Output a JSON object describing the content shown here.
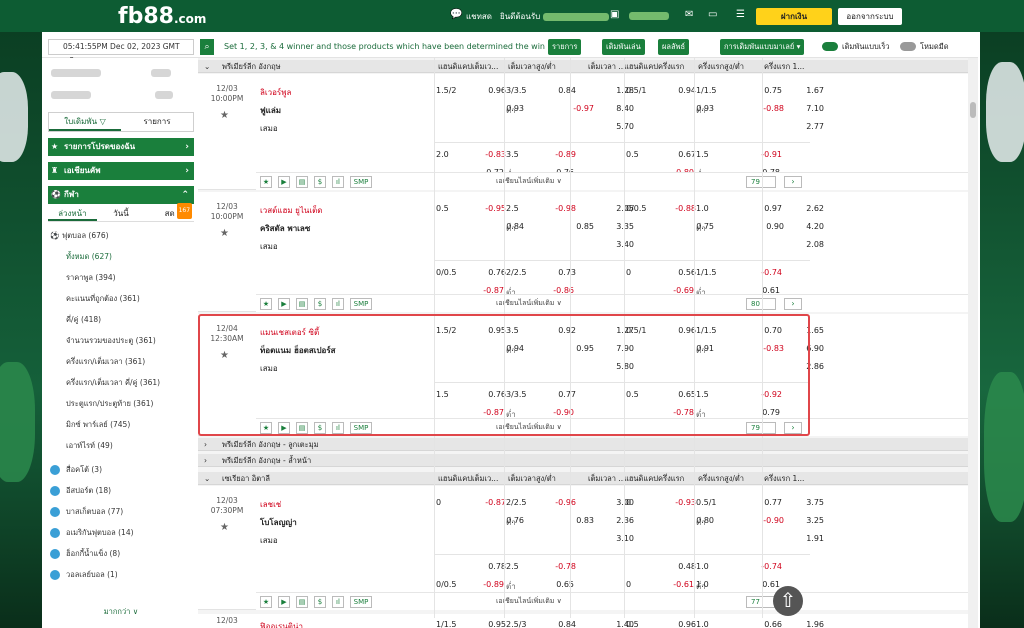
{
  "header": {
    "logo": "fb88",
    "logo_tld": ".com",
    "live_label": "แชทสด",
    "welcome": "ยินดีต้อนรับ",
    "deposit": "ฝากเงิน",
    "logout": "ออกจากระบบ"
  },
  "infobar": {
    "datetime": "05:41:55PM Dec 02, 2023 GMT +8",
    "marquee": "Set 1, 2, 3, & 4 winner and those products which have been determined the win",
    "b1": "รายการ",
    "b2": "เดิมพันเล่น",
    "b3": "ผลลัพธ์",
    "b4": "การเดิมพันแบบมาเลย์ ▾",
    "t1": "เดิมพันแบบเร็ว",
    "t2": "โหมดมืด"
  },
  "sidebar": {
    "tabs": [
      "ใบเดิมพัน ▽",
      "รายการ"
    ],
    "sections": [
      "รายการโปรดของฉัน",
      "เอเชียนคัพ",
      "กีฬา"
    ],
    "subtabs": [
      "ล่วงหน้า",
      "วันนี้",
      "สด"
    ],
    "live_count": "167",
    "items": [
      {
        "icon": "⚽",
        "label": "ฟุตบอล (676)"
      },
      {
        "label": "ทั้งหมด (627)"
      },
      {
        "label": "ราคาพูล (394)"
      },
      {
        "label": "คะแนนที่ถูกต้อง (361)"
      },
      {
        "label": "คี่/คู่ (418)"
      },
      {
        "label": "จำนวนรวมของประตู (361)"
      },
      {
        "label": "ครึ่งแรก/เต็มเวลา (361)"
      },
      {
        "label": "ครึ่งแรก/เต็มเวลา คี่/คู่ (361)"
      },
      {
        "label": "ประตูแรก/ประตูท้าย (361)"
      },
      {
        "label": "มิกซ์ พาร์เลย์ (745)"
      },
      {
        "label": "เอาท์ไรท์ (49)"
      }
    ],
    "others": [
      {
        "label": "สื่อคโต้ (3)"
      },
      {
        "label": "อีสปอร์ต (18)"
      },
      {
        "label": "บาสเก็ตบอล (77)"
      },
      {
        "label": "อเมริกันฟุตบอล (14)"
      },
      {
        "label": "ฮ็อกกี้น้ำแข็ง (8)"
      },
      {
        "label": "วอลเลย์บอล (1)"
      }
    ],
    "more": "มากกว่า ∨"
  },
  "columns": [
    "แฮนดิแคปเต็มเว...",
    "เต็มเวลาสูง/ต่ำ",
    "เต็มเวลา ...",
    "แฮนดิแคปครึ่งแรก",
    "ครึ่งแรกสูง/ต่ำ",
    "ครึ่งแรก 1..."
  ],
  "leagues": {
    "epl": "พรีเมียร์ลีก อังกฤษ",
    "epl_corners": "พรีเมียร์ลีก อังกฤษ - ลูกเตะมุม",
    "epl_extra": "พรีเมียร์ลีก อังกฤษ - ล้ำหน้า",
    "seriea": "เซเรียอา อิตาลี"
  },
  "common": {
    "draw": "เสมอ",
    "low": "ต่ำ",
    "more_bets": "เอเชียนไลน์เพิ่มเติม ∨",
    "smp": "SMP"
  },
  "matches": [
    {
      "date": "12/03",
      "time": "10:00PM",
      "home": "ลิเวอร์พูล",
      "away": "ฟูแล่ม",
      "r1": [
        "1.5/2",
        "0.96",
        "3/3.5",
        "0.84",
        "1.28",
        "0.5/1",
        "0.94",
        "1/1.5",
        "0.75",
        "1.67"
      ],
      "r2": [
        "0.93",
        "-0.97",
        "8.40",
        "0.93",
        "-0.88",
        "7.10"
      ],
      "r3": [
        "5.70",
        "2.77"
      ],
      "s1": [
        "2.0",
        "-0.83",
        "3.5",
        "-0.89",
        "0.5",
        "0.67",
        "1.5",
        "-0.91"
      ],
      "s2": [
        "0.72",
        "0.76",
        "-0.80",
        "0.78"
      ],
      "count": "79"
    },
    {
      "date": "12/03",
      "time": "10:00PM",
      "home": "เวสต์แฮม ยูไนเต็ด",
      "away": "คริสตัล พาเลซ",
      "r1": [
        "0.5",
        "-0.95",
        "2.5",
        "-0.98",
        "2.05",
        "0/0.5",
        "-0.88",
        "1.0",
        "0.97",
        "2.62"
      ],
      "r2": [
        "0.84",
        "0.85",
        "3.35",
        "0.75",
        "0.90",
        "4.20"
      ],
      "r3": [
        "3.40",
        "2.08"
      ],
      "s1": [
        "0/0.5",
        "0.76",
        "2/2.5",
        "0.73",
        "0",
        "0.56",
        "1/1.5",
        "-0.74"
      ],
      "s2": [
        "-0.87",
        "-0.86",
        "-0.69",
        "0.61"
      ],
      "count": "80"
    },
    {
      "date": "12/04",
      "time": "12:30AM",
      "home": "แมนเชสเตอร์ ซิตี้",
      "away": "ท็อตแนม ฮ็อตสเปอร์ส",
      "r1": [
        "1.5/2",
        "0.95",
        "3.5",
        "0.92",
        "1.27",
        "0.5/1",
        "0.96",
        "1/1.5",
        "0.70",
        "1.65"
      ],
      "r2": [
        "0.94",
        "0.95",
        "7.90",
        "0.91",
        "-0.83",
        "6.90"
      ],
      "r3": [
        "5.80",
        "2.86"
      ],
      "s1": [
        "1.5",
        "0.76",
        "3/3.5",
        "0.77",
        "0.5",
        "0.65",
        "1.5",
        "-0.92"
      ],
      "s2": [
        "-0.87",
        "-0.90",
        "-0.78",
        "0.79"
      ],
      "count": "79"
    },
    {
      "date": "12/03",
      "time": "07:30PM",
      "home": "เลชเช่",
      "away": "โบโลญญ่า",
      "r1": [
        "0",
        "-0.87",
        "2/2.5",
        "-0.96",
        "3.00",
        "0",
        "-0.93",
        "0.5/1",
        "0.77",
        "3.75"
      ],
      "r2": [
        "0.76",
        "0.83",
        "2.36",
        "0.80",
        "-0.90",
        "3.25"
      ],
      "r3": [
        "3.10",
        "1.91"
      ],
      "s1": [
        "",
        "0.78",
        "2.5",
        "-0.78",
        "",
        "0.48",
        "1.0",
        "-0.74"
      ],
      "s2": [
        "-0.89",
        "0.65",
        "-0.61",
        "0.61"
      ],
      "s1b": [
        "0/0.5",
        "0",
        "1.0"
      ],
      "count": "77"
    }
  ],
  "last": {
    "date": "12/03",
    "home": "ฟิออเรนติน่า",
    "vals": [
      "1/1.5",
      "0.95",
      "2.5/3",
      "0.84",
      "1.40",
      "0.5",
      "0.96",
      "1.0",
      "0.66",
      "1.96"
    ]
  }
}
